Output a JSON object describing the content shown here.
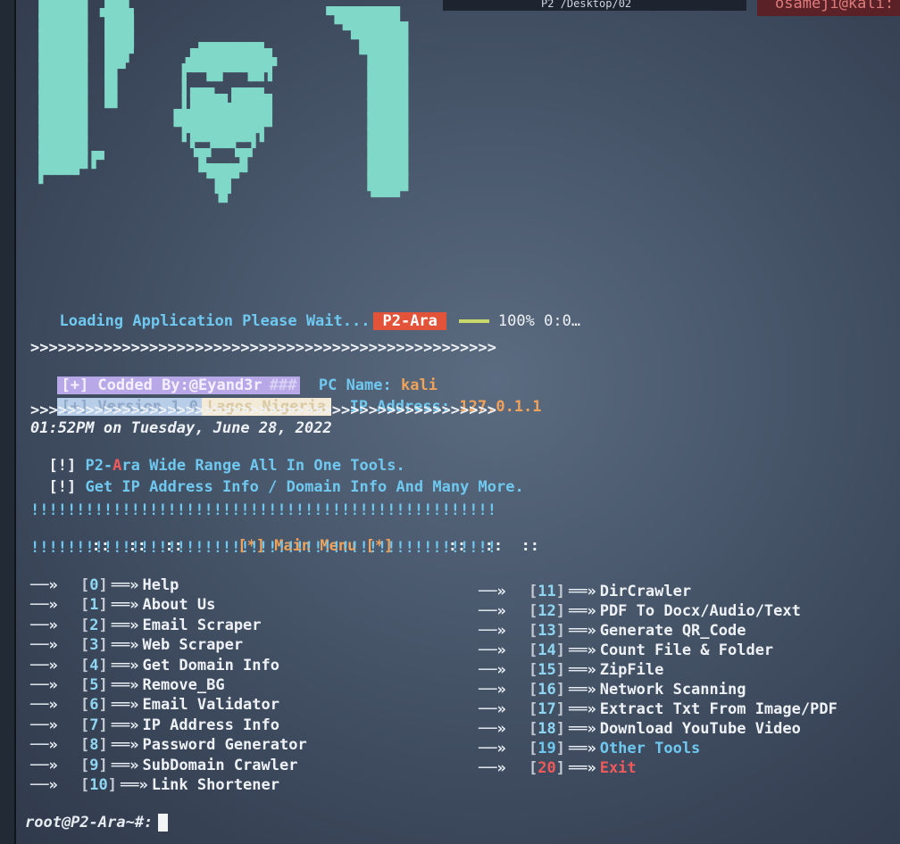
{
  "topbar": {
    "tab1": "P2  /Desktop/02",
    "tab2": "osameji@kali:"
  },
  "loading": {
    "text": "Loading Application Please Wait...",
    "badge": "P2-Ara",
    "percent": "100%",
    "time": "0:0…"
  },
  "separator": ">>>>>>>>>>>>>>>>>>>>>>>>>>>>>>>>>>>>>>>>>>>>>>>>>>>",
  "info": {
    "codded_by": "[+] Codded By:@Eyand3r",
    "hash": "###",
    "pc_name_label": "PC Name:",
    "pc_name_value": "kali",
    "version": "[+] Version.1.0",
    "location": "Lagos Nigeria",
    "ip_label": "IP Address:",
    "ip_value": "127.0.1.1"
  },
  "datetime": "01:52PM on Tuesday, June 28, 2022",
  "notes": {
    "line1_prefix": "[!]",
    "line1_brand_a": "P2-",
    "line1_brand_b": "A",
    "line1_brand_c": "ra",
    "line1_rest": " Wide Range All In One Tools.",
    "line2_prefix": "[!]",
    "line2_text": "Get IP Address Info / Domain Info And Many More."
  },
  "bang_line": "!!!!!!!!!!!!!!!!!!!!!!!!!!!!!!!!!!!!!!!!!!!!!!!!!!!",
  "menu_header": {
    "colons_left": "::  ::  ::",
    "title": "[*] Main Menu [*]",
    "colons_right": "::  ::  ::"
  },
  "menu": {
    "left": [
      {
        "num": "0",
        "label": "Help"
      },
      {
        "num": "1",
        "label": "About Us"
      },
      {
        "num": "2",
        "label": "Email Scraper"
      },
      {
        "num": "3",
        "label": "Web Scraper"
      },
      {
        "num": "4",
        "label": "Get Domain Info"
      },
      {
        "num": "5",
        "label": "Remove_BG"
      },
      {
        "num": "6",
        "label": "Email Validator"
      },
      {
        "num": "7",
        "label": "IP Address Info"
      },
      {
        "num": "8",
        "label": "Password Generator"
      },
      {
        "num": "9",
        "label": "SubDomain Crawler"
      },
      {
        "num": "10",
        "label": "Link Shortener"
      }
    ],
    "right": [
      {
        "num": "11",
        "label": "DirCrawler"
      },
      {
        "num": "12",
        "label": "PDF To Docx/Audio/Text"
      },
      {
        "num": "13",
        "label": "Generate QR_Code"
      },
      {
        "num": "14",
        "label": "Count File & Folder"
      },
      {
        "num": "15",
        "label": "ZipFile"
      },
      {
        "num": "16",
        "label": "Network Scanning"
      },
      {
        "num": "17",
        "label": "Extract Txt From Image/PDF"
      },
      {
        "num": "18",
        "label": "Download YouTube Video"
      },
      {
        "num": "19",
        "label": "Other Tools"
      },
      {
        "num": "20",
        "label": "Exit"
      }
    ]
  },
  "prompt": "root@P2-Ara~#:"
}
